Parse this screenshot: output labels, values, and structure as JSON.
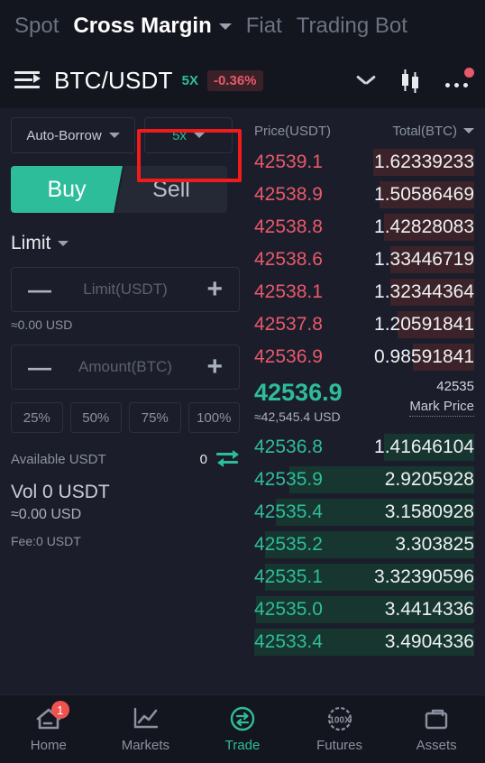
{
  "top_tabs": [
    {
      "label": "Spot",
      "active": false
    },
    {
      "label": "Cross Margin",
      "active": true
    },
    {
      "label": "Fiat",
      "active": false
    },
    {
      "label": "Trading Bot",
      "active": false
    }
  ],
  "pair_header": {
    "menu_icon": "hamburger-list-icon",
    "pair": "BTC/USDT",
    "leverage_badge": "5X",
    "change_badge": "-0.36%",
    "chevron_icon": "chevron-down-icon",
    "chart_icon": "candlestick-chart-icon",
    "more_icon": "more-options-icon"
  },
  "order_form": {
    "borrow_mode": "Auto-Borrow",
    "leverage": "5x",
    "buy_label": "Buy",
    "sell_label": "Sell",
    "order_type": "Limit",
    "price_placeholder": "Limit(USDT)",
    "price_value": "",
    "price_approx": "≈0.00 USD",
    "amount_placeholder": "Amount(BTC)",
    "amount_value": "",
    "percent_options": [
      "25%",
      "50%",
      "75%",
      "100%"
    ],
    "available_label": "Available USDT",
    "available_value": "0",
    "swap_icon": "transfer-swap-icon",
    "volume": "Vol 0 USDT",
    "volume_usd": "≈0.00 USD",
    "fee": "Fee:0 USDT"
  },
  "annotation": {
    "target": "leverage-selector",
    "color": "#f21b1b"
  },
  "order_book": {
    "header_price": "Price(USDT)",
    "header_total": "Total(BTC)",
    "sort_icon": "chevron-down-icon",
    "asks": [
      {
        "price": "42539.1",
        "total": "1.62339233",
        "depth": 46
      },
      {
        "price": "42538.9",
        "total": "1.50586469",
        "depth": 43
      },
      {
        "price": "42538.8",
        "total": "1.42828083",
        "depth": 41
      },
      {
        "price": "42538.6",
        "total": "1.33446719",
        "depth": 38
      },
      {
        "price": "42538.1",
        "total": "1.32344364",
        "depth": 38
      },
      {
        "price": "42537.8",
        "total": "1.20591841",
        "depth": 35
      },
      {
        "price": "42536.9",
        "total": "0.98591841",
        "depth": 28
      }
    ],
    "last_price": "42536.9",
    "last_price_usd": "≈42,545.4 USD",
    "mark_price_value": "42535",
    "mark_price_label": "Mark Price",
    "bids": [
      {
        "price": "42536.8",
        "total": "1.41646104",
        "depth": 41
      },
      {
        "price": "42535.9",
        "total": "2.9205928",
        "depth": 84
      },
      {
        "price": "42535.4",
        "total": "3.1580928",
        "depth": 90
      },
      {
        "price": "42535.2",
        "total": "3.303825",
        "depth": 95
      },
      {
        "price": "42535.1",
        "total": "3.32390596",
        "depth": 95
      },
      {
        "price": "42535.0",
        "total": "3.4414336",
        "depth": 99
      },
      {
        "price": "42533.4",
        "total": "3.4904336",
        "depth": 100
      }
    ]
  },
  "bottom_nav": [
    {
      "label": "Home",
      "icon": "home-icon",
      "badge": "1",
      "active": false
    },
    {
      "label": "Markets",
      "icon": "chart-line-icon",
      "badge": "",
      "active": false
    },
    {
      "label": "Trade",
      "icon": "trade-swap-circle-icon",
      "badge": "",
      "active": true
    },
    {
      "label": "Futures",
      "icon": "futures-100x-icon",
      "badge": "",
      "active": false
    },
    {
      "label": "Assets",
      "icon": "briefcase-icon",
      "badge": "",
      "active": false
    }
  ],
  "colors": {
    "accent_green": "#2ebd9a",
    "accent_red": "#e8596a",
    "annotation_red": "#f21b1b"
  }
}
